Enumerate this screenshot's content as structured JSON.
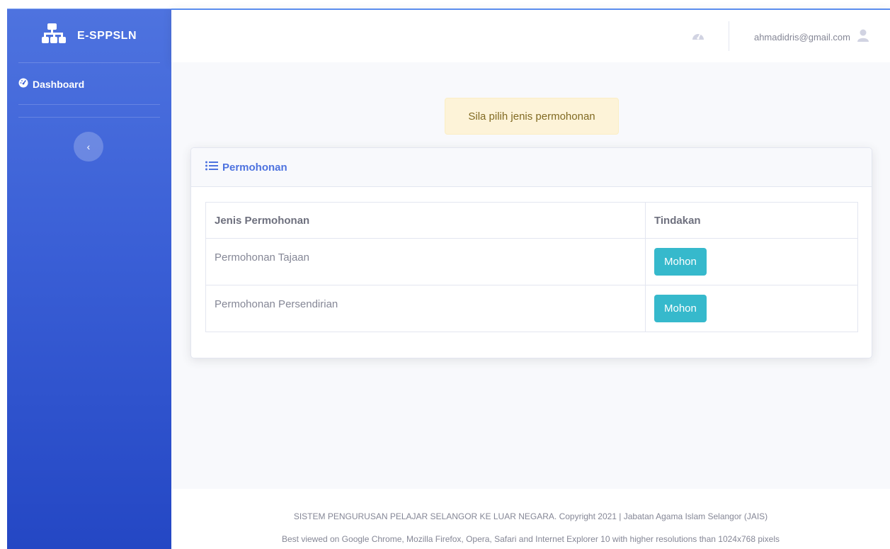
{
  "brand": {
    "name": "E-SPPSLN",
    "icon": "sitemap-icon"
  },
  "sidebar": {
    "items": [
      {
        "label": "Dashboard",
        "icon": "tachometer-icon"
      }
    ],
    "toggle_icon": "chevron-left-icon"
  },
  "topbar": {
    "icon": "tachometer-icon",
    "user_email": "ahmadidris@gmail.com",
    "user_icon": "user-icon"
  },
  "alert": {
    "text": "Sila pilih jenis permohonan"
  },
  "card": {
    "title": "Permohonan",
    "title_icon": "list-icon",
    "table": {
      "headers": [
        "Jenis Permohonan",
        "Tindakan"
      ],
      "rows": [
        {
          "name": "Permohonan Tajaan",
          "action": "Mohon"
        },
        {
          "name": "Permohonan Persendirian",
          "action": "Mohon"
        }
      ]
    }
  },
  "footer": {
    "line1": "SISTEM PENGURUSAN PELAJAR SELANGOR KE LUAR NEGARA. Copyright 2021 | Jabatan Agama Islam Selangor (JAIS)",
    "line2": "Best viewed on Google Chrome, Mozilla Firefox, Opera, Safari and Internet Explorer 10 with higher resolutions than 1024x768 pixels"
  },
  "colors": {
    "primary": "#4e73df",
    "info": "#36b9cc",
    "alert_bg": "#fdf3d8",
    "alert_text": "#816a22",
    "muted_text": "#858796"
  }
}
